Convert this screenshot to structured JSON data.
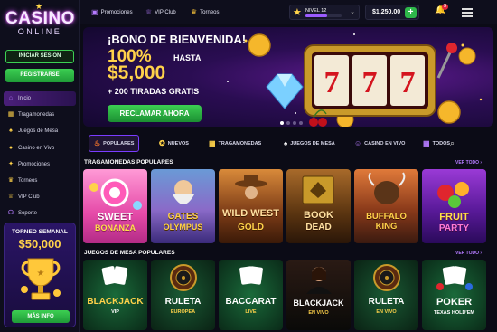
{
  "logo": {
    "top": "CASINO",
    "bottom": "ONLINE"
  },
  "sidebar": {
    "login_label": "INICIAR SESIÓN",
    "register_label": "REGISTRARSE",
    "items": [
      {
        "label": "Inicio",
        "icon": "home-icon"
      },
      {
        "label": "Tragamonedas",
        "icon": "slot-icon"
      },
      {
        "label": "Juegos de Mesa",
        "icon": "cards-icon"
      },
      {
        "label": "Casino en Vivo",
        "icon": "live-icon"
      },
      {
        "label": "Promociones",
        "icon": "gift-icon"
      },
      {
        "label": "Torneos",
        "icon": "trophy-icon"
      },
      {
        "label": "VIP Club",
        "icon": "crown-icon"
      },
      {
        "label": "Soporte",
        "icon": "headset-icon"
      }
    ],
    "promo": {
      "title": "TORNEO SEMANAL",
      "amount": "$50,000",
      "button": "MÁS INFO"
    }
  },
  "header": {
    "links": [
      "Promociones",
      "VIP Club",
      "Torneos"
    ],
    "level_label": "NIVEL 12",
    "level_progress": 0.6,
    "balance": "$1,250.00",
    "notifications": "3"
  },
  "banner": {
    "line1": "¡BONO DE BIENVENIDA!",
    "line2_big": "100%",
    "line2_small": "HASTA",
    "line3": "$5,000",
    "line4": "+ 200 TIRADAS GRATIS",
    "cta": "RECLAMAR AHORA",
    "reels": [
      "7",
      "7",
      "7"
    ]
  },
  "tabs": [
    "POPULARES",
    "NUEVOS",
    "TRAGAMONEDAS",
    "JUEGOS DE MESA",
    "CASINO EN VIVO",
    "TODOS"
  ],
  "sections": {
    "slots": {
      "title": "TRAGAMONEDAS POPULARES",
      "see_all": "VER TODO ›",
      "games": [
        {
          "name": "SWEET",
          "sub": "BONANZA"
        },
        {
          "name": "GATES",
          "sub": "OLYMPUS"
        },
        {
          "name": "WILD WEST",
          "sub": "GOLD"
        },
        {
          "name": "BOOK",
          "sub": "DEAD"
        },
        {
          "name": "BUFFALO",
          "sub": "KING"
        },
        {
          "name": "FRUIT",
          "sub": "PARTY"
        }
      ]
    },
    "table": {
      "title": "JUEGOS DE MESA POPULARES",
      "see_all": "VER TODO ›",
      "games": [
        {
          "name": "BLACKJACK",
          "sub": "VIP"
        },
        {
          "name": "RULETA",
          "sub": "EUROPEA"
        },
        {
          "name": "BACCARAT",
          "sub": "LIVE"
        },
        {
          "name": "BLACKJACK",
          "sub": "EN VIVO"
        },
        {
          "name": "RULETA",
          "sub": "EN VIVO"
        },
        {
          "name": "POKER",
          "sub": "TEXAS HOLD'EM"
        }
      ]
    }
  }
}
